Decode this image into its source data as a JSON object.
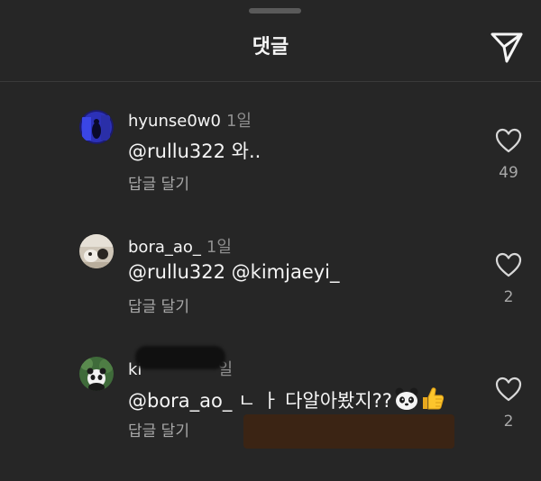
{
  "header": {
    "title": "댓글",
    "share_icon": "paper-plane-icon"
  },
  "colors": {
    "background": "#262626",
    "text_primary": "#f5f5f5",
    "text_secondary": "#a8a8a8"
  },
  "comments": [
    {
      "username": "hyunse0w0",
      "time": "1일",
      "text": "@rullu322 와..",
      "reply_label": "답글 달기",
      "likes": "49"
    },
    {
      "username": "bora_ao_",
      "time": "1일",
      "text": "@rullu322 @kimjaeyi_",
      "reply_label": "답글 달기",
      "likes": "2"
    },
    {
      "username": "ki",
      "time": "일",
      "text": "@bora_ao_ ㄴ ㅏ 다알아봤지??",
      "emojis": [
        "panda-emoji",
        "thumbs-up-emoji"
      ],
      "reply_label": "답글 달기",
      "likes": "2"
    }
  ]
}
